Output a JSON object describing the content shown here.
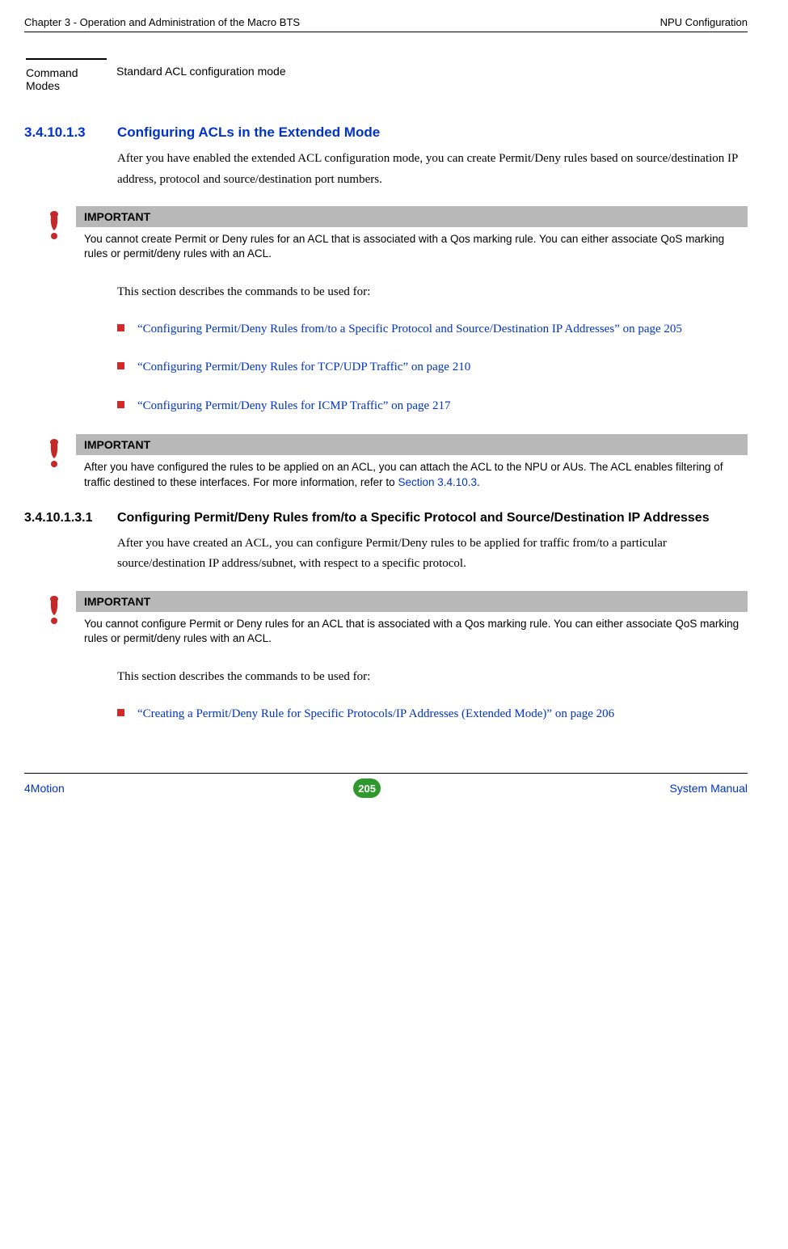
{
  "header": {
    "left": "Chapter 3 - Operation and Administration of the Macro BTS",
    "right": "NPU Configuration"
  },
  "cmd_modes": {
    "label": "Command Modes",
    "value": "Standard ACL configuration mode"
  },
  "sec1": {
    "num": "3.4.10.1.3",
    "title": "Configuring ACLs in the Extended Mode",
    "para1": "After you have enabled the extended ACL configuration mode, you can create Permit/Deny rules based on source/destination IP address, protocol and source/destination port numbers.",
    "para2": "This section describes the commands to be used for:"
  },
  "important1": {
    "header": "IMPORTANT",
    "body": "You cannot create Permit or Deny rules for an ACL that is associated with a Qos marking rule. You can either associate QoS marking rules or permit/deny rules with an ACL."
  },
  "bullets1": {
    "b1": "“Configuring Permit/Deny Rules from/to a Specific Protocol and Source/Destination IP Addresses” on page 205",
    "b2": "“Configuring Permit/Deny Rules for TCP/UDP Traffic” on page 210",
    "b3": "“Configuring Permit/Deny Rules for ICMP Traffic” on page 217"
  },
  "important2": {
    "header": "IMPORTANT",
    "body_pre": "After you have configured the rules to be applied on an ACL, you can attach the ACL to the NPU or AUs. The ACL enables filtering of traffic destined to these interfaces. For more information, refer to ",
    "body_link": "Section 3.4.10.3",
    "body_post": "."
  },
  "sec2": {
    "num": "3.4.10.1.3.1",
    "title": "Configuring Permit/Deny Rules from/to a Specific Protocol and Source/Destination IP Addresses",
    "para1": "After you have created an ACL, you can configure Permit/Deny rules to be applied for traffic from/to a particular source/destination IP address/subnet, with respect to a specific protocol.",
    "para2": "This section describes the commands to be used for:"
  },
  "important3": {
    "header": "IMPORTANT",
    "body": "You cannot configure Permit or Deny rules for an ACL that is associated with a Qos marking rule. You can either associate QoS marking rules or permit/deny rules with an ACL."
  },
  "bullets2": {
    "b1": "“Creating a Permit/Deny Rule for Specific Protocols/IP Addresses (Extended Mode)” on page 206"
  },
  "footer": {
    "left": "4Motion",
    "center": "205",
    "right": "System Manual"
  }
}
